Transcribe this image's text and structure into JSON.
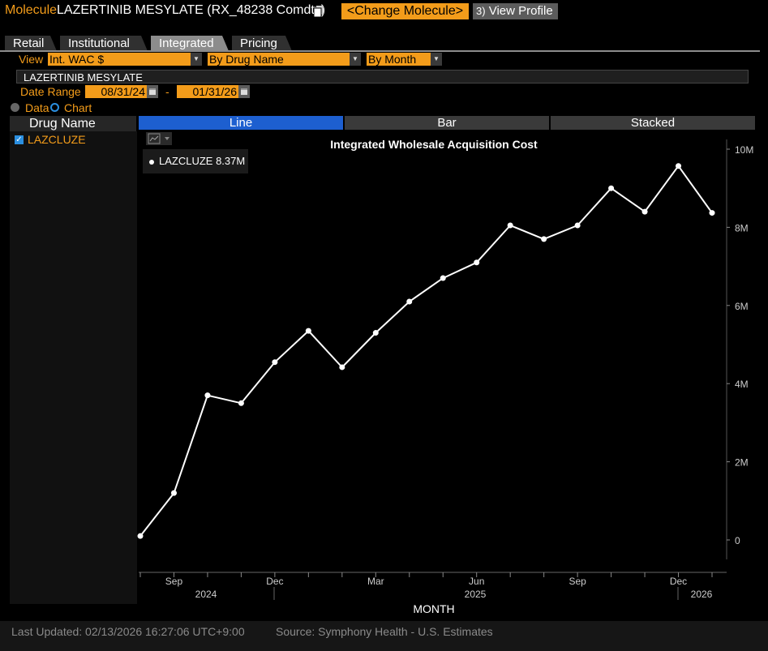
{
  "header": {
    "molecule_label": "Molecule",
    "molecule_name": "LAZERTINIB MESYLATE (RX_48238 Comdty)",
    "change_button": "<Change Molecule>",
    "profile_number": "3)",
    "profile_button": "View Profile"
  },
  "tabs": [
    "Retail",
    "Institutional",
    "Integrated",
    "Pricing"
  ],
  "controls": {
    "view_label": "View",
    "view_select": "Int. WAC $",
    "group_select": "By Drug Name",
    "period_select": "By Month",
    "molecule_bar": "LAZERTINIB MESYLATE",
    "date_range_label": "Date Range",
    "date_start": "08/31/24",
    "date_sep": "-",
    "date_end": "01/31/26",
    "data_label": "Data",
    "chart_label": "Chart"
  },
  "left": {
    "header": "Drug Name",
    "drug": "LAZCLUZE"
  },
  "chart_tabs": [
    "Line",
    "Bar",
    "Stacked"
  ],
  "tooltip": "LAZCLUZE  8.37M",
  "chart_data": {
    "type": "line",
    "title": "Integrated Wholesale Acquisition Cost",
    "xlabel": "MONTH",
    "ylabel": "",
    "x": [
      "2024-08",
      "2024-09",
      "2024-10",
      "2024-11",
      "2024-12",
      "2025-01",
      "2025-02",
      "2025-03",
      "2025-04",
      "2025-05",
      "2025-06",
      "2025-07",
      "2025-08",
      "2025-09",
      "2025-10",
      "2025-11",
      "2025-12",
      "2026-01"
    ],
    "series": [
      {
        "name": "LAZCLUZE",
        "values": [
          0.1,
          1.2,
          3.7,
          3.5,
          4.55,
          5.35,
          4.42,
          5.3,
          6.1,
          6.7,
          7.1,
          8.05,
          7.7,
          8.05,
          9.0,
          8.4,
          9.57,
          8.37
        ]
      }
    ],
    "yticks": [
      "0",
      "2M",
      "4M",
      "6M",
      "8M",
      "10M"
    ],
    "ylim": [
      -0.3,
      10.3
    ],
    "y_unit": "millions",
    "xtick_labels": [
      "Sep",
      "Dec",
      "Mar",
      "Jun",
      "Sep",
      "Dec"
    ],
    "year_labels": [
      "2024",
      "2025",
      "2026"
    ],
    "line_color": "#ffffff",
    "axis_position": "right"
  },
  "footer": {
    "updated": "Last Updated: 02/13/2026 16:27:06 UTC+9:00",
    "source": "Source: Symphony Health - U.S. Estimates"
  },
  "colors": {
    "accent": "#f39c1a",
    "active_tab": "#1d5fd0",
    "checkbox": "#2b8fe0"
  }
}
